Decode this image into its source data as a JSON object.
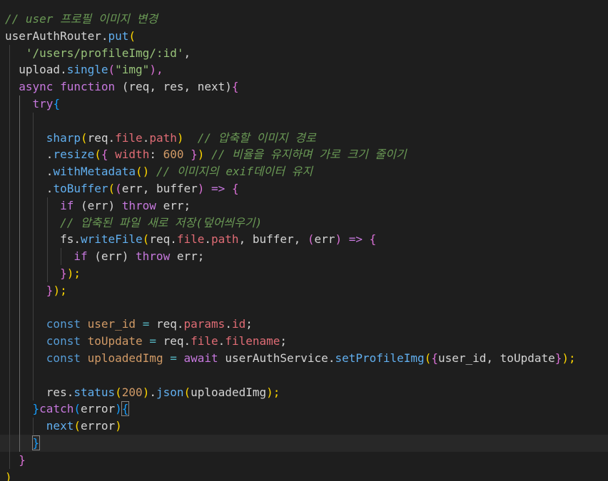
{
  "editor": {
    "theme_colors": {
      "background": "#1e1e1e",
      "comment": "#6a9955",
      "function": "#61afef",
      "keyword": "#c678dd",
      "string": "#98c379",
      "property": "#e06c75",
      "number": "#d19a66"
    },
    "lines": [
      {
        "text": "// user 프로필 이미지 변경"
      },
      {
        "text": "userAuthRouter.put("
      },
      {
        "text": "'/users/profileImg/:id',"
      },
      {
        "text": "upload.single(\"img\"),"
      },
      {
        "text": "async function (req, res, next){"
      },
      {
        "text": "try{"
      },
      {
        "text": ""
      },
      {
        "text": "sharp(req.file.path)  // 압축할 이미지 경로"
      },
      {
        "text": ".resize({ width: 600 }) // 비율을 유지하며 가로 크기 줄이기"
      },
      {
        "text": ".withMetadata() // 이미지의 exif데이터 유지"
      },
      {
        "text": ".toBuffer((err, buffer) => {"
      },
      {
        "text": "if (err) throw err;"
      },
      {
        "text": "// 압축된 파일 새로 저장(덮어씌우기)"
      },
      {
        "text": "fs.writeFile(req.file.path, buffer, (err) => {"
      },
      {
        "text": "if (err) throw err;"
      },
      {
        "text": "});"
      },
      {
        "text": "});"
      },
      {
        "text": ""
      },
      {
        "text": "const user_id = req.params.id;"
      },
      {
        "text": "const toUpdate = req.file.filename;"
      },
      {
        "text": "const uploadedImg = await userAuthService.setProfileImg({user_id, toUpdate});"
      },
      {
        "text": ""
      },
      {
        "text": "res.status(200).json(uploadedImg);"
      },
      {
        "text": "}catch(error){"
      },
      {
        "text": "next(error)"
      },
      {
        "text": "}"
      },
      {
        "text": "}"
      },
      {
        "text": ")"
      }
    ],
    "tokens": {
      "l0_comment": "// user 프로필 이미지 변경",
      "l1_a": "userAuthRouter",
      "l1_b": ".",
      "l1_c": "put",
      "l1_d": "(",
      "l2_a": "'/users/profileImg/:id'",
      "l2_b": ",",
      "l3_a": "upload",
      "l3_b": ".",
      "l3_c": "single",
      "l3_d": "(",
      "l3_e": "\"img\"",
      "l3_f": "),",
      "l4_a": "async",
      "l4_b": " ",
      "l4_c": "function",
      "l4_d": " (",
      "l4_e": "req",
      "l4_f": ", ",
      "l4_g": "res",
      "l4_h": ", ",
      "l4_i": "next",
      "l4_j": ")",
      "l4_k": "{",
      "l5_a": "try",
      "l5_b": "{",
      "l7_a": "sharp",
      "l7_b": "(",
      "l7_c": "req",
      "l7_d": ".",
      "l7_e": "file",
      "l7_f": ".",
      "l7_g": "path",
      "l7_h": ")",
      "l7_i": "  ",
      "l7_comment": "// 압축할 이미지 경로",
      "l8_a": ".",
      "l8_b": "resize",
      "l8_c": "(",
      "l8_d": "{",
      "l8_e": " ",
      "l8_f": "width",
      "l8_g": ": ",
      "l8_h": "600",
      "l8_i": " ",
      "l8_j": "}",
      "l8_k": ")",
      "l8_l": " ",
      "l8_comment": "// 비율을 유지하며 가로 크기 줄이기",
      "l9_a": ".",
      "l9_b": "withMetadata",
      "l9_c": "()",
      "l9_d": " ",
      "l9_comment": "// 이미지의 exif데이터 유지",
      "l10_a": ".",
      "l10_b": "toBuffer",
      "l10_c": "(",
      "l10_d": "(",
      "l10_e": "err",
      "l10_f": ", ",
      "l10_g": "buffer",
      "l10_h": ")",
      "l10_i": " ",
      "l10_j": "=>",
      "l10_k": " ",
      "l10_l": "{",
      "l11_a": "if",
      "l11_b": " (",
      "l11_c": "err",
      "l11_d": ") ",
      "l11_e": "throw",
      "l11_f": " ",
      "l11_g": "err",
      "l11_h": ";",
      "l12_comment": "// 압축된 파일 새로 저장(덮어씌우기)",
      "l13_a": "fs",
      "l13_b": ".",
      "l13_c": "writeFile",
      "l13_d": "(",
      "l13_e": "req",
      "l13_f": ".",
      "l13_g": "file",
      "l13_h": ".",
      "l13_i": "path",
      "l13_j": ", ",
      "l13_k": "buffer",
      "l13_l": ", ",
      "l13_m": "(",
      "l13_n": "err",
      "l13_o": ")",
      "l13_p": " ",
      "l13_q": "=>",
      "l13_r": " ",
      "l13_s": "{",
      "l14_a": "if",
      "l14_b": " (",
      "l14_c": "err",
      "l14_d": ") ",
      "l14_e": "throw",
      "l14_f": " ",
      "l14_g": "err",
      "l14_h": ";",
      "l15_a": "}",
      "l15_b": ");",
      "l16_a": "}",
      "l16_b": ");",
      "l18_a": "const",
      "l18_b": " ",
      "l18_c": "user_id",
      "l18_d": " ",
      "l18_e": "=",
      "l18_f": " ",
      "l18_g": "req",
      "l18_h": ".",
      "l18_i": "params",
      "l18_j": ".",
      "l18_k": "id",
      "l18_l": ";",
      "l19_a": "const",
      "l19_b": " ",
      "l19_c": "toUpdate",
      "l19_d": " ",
      "l19_e": "=",
      "l19_f": " ",
      "l19_g": "req",
      "l19_h": ".",
      "l19_i": "file",
      "l19_j": ".",
      "l19_k": "filename",
      "l19_l": ";",
      "l20_a": "const",
      "l20_b": " ",
      "l20_c": "uploadedImg",
      "l20_d": " ",
      "l20_e": "=",
      "l20_f": " ",
      "l20_g": "await",
      "l20_h": " ",
      "l20_i": "userAuthService",
      "l20_j": ".",
      "l20_k": "setProfileImg",
      "l20_l": "(",
      "l20_m": "{",
      "l20_n": "user_id",
      "l20_o": ", ",
      "l20_p": "toUpdate",
      "l20_q": "}",
      "l20_r": ");",
      "l22_a": "res",
      "l22_b": ".",
      "l22_c": "status",
      "l22_d": "(",
      "l22_e": "200",
      "l22_f": ")",
      "l22_g": ".",
      "l22_h": "json",
      "l22_i": "(",
      "l22_j": "uploadedImg",
      "l22_k": ");",
      "l23_a": "}",
      "l23_b": "catch",
      "l23_c": "(",
      "l23_d": "error",
      "l23_e": ")",
      "l23_f": "{",
      "l24_a": "next",
      "l24_b": "(",
      "l24_c": "error",
      "l24_d": ")",
      "l25_a": "}",
      "l26_a": "}",
      "l27_a": ")"
    }
  }
}
